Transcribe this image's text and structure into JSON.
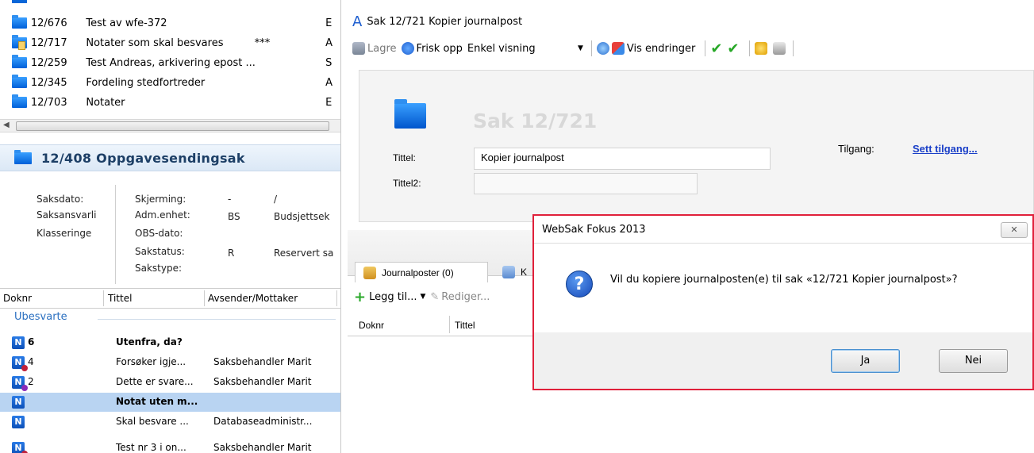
{
  "case_list": [
    {
      "number": "12/676",
      "title": "Test av wfe-372",
      "mark": "",
      "tail": "E",
      "icon": "folder-icon"
    },
    {
      "number": "12/717",
      "title": "Notater som skal besvares",
      "mark": "***",
      "tail": "A",
      "icon": "folder-note-icon"
    },
    {
      "number": "12/259",
      "title": "Test Andreas, arkivering epost ...",
      "mark": "",
      "tail": "S",
      "icon": "folder-icon"
    },
    {
      "number": "12/345",
      "title": "Fordeling stedfortreder",
      "mark": "",
      "tail": "A",
      "icon": "folder-icon"
    },
    {
      "number": "12/703",
      "title": "Notater",
      "mark": "",
      "tail": "E",
      "icon": "folder-icon"
    }
  ],
  "case_detail": {
    "header": "12/408  Oppgavesendingsak",
    "labels_left": [
      "Saksdato:",
      "Saksansvarli",
      "Klasseringe"
    ],
    "labels_mid": [
      "Skjerming:",
      "Adm.enhet:",
      "OBS-dato:",
      "Sakstatus:",
      "Sakstype:"
    ],
    "values_code": [
      "-",
      "BS",
      "",
      "R",
      ""
    ],
    "values_text": [
      "/",
      "Budsjettsek",
      "",
      "Reservert sa",
      ""
    ]
  },
  "doc_table": {
    "headers": [
      "Doknr",
      "Tittel",
      "Avsender/Mottaker"
    ],
    "group": "Ubesvarte",
    "rows": [
      {
        "num": "6",
        "title": "Utenfra, da?",
        "sender": "",
        "bold": true,
        "selected": false,
        "badge": ""
      },
      {
        "num": "4",
        "title": "Forsøker igje...",
        "sender": "Saksbehandler Marit",
        "bold": false,
        "selected": false,
        "badge": "#c0203a"
      },
      {
        "num": "2",
        "title": "Dette er svare...",
        "sender": "Saksbehandler Marit",
        "bold": false,
        "selected": false,
        "badge": "#8a2bb8"
      },
      {
        "num": "",
        "title": "Notat uten m...",
        "sender": "",
        "bold": true,
        "selected": true,
        "badge": ""
      },
      {
        "num": "",
        "title": "Skal besvare ...",
        "sender": "Databaseadministr...",
        "bold": false,
        "selected": false,
        "badge": ""
      },
      {
        "num": "",
        "title": "Test nr 3 i on...",
        "sender": "Saksbehandler Marit",
        "bold": false,
        "selected": false,
        "badge": "#c0203a"
      }
    ]
  },
  "window": {
    "title": "Sak 12/721 Kopier journalpost",
    "app_letter": "A"
  },
  "toolbar": {
    "save": "Lagre",
    "refresh": "Frisk opp",
    "view": "Enkel visning",
    "show_changes": "Vis endringer"
  },
  "case_form": {
    "heading": "Sak 12/721",
    "title_label": "Tittel:",
    "title_value": "Kopier journalpost",
    "title2_label": "Tittel2:",
    "title2_value": "",
    "access_label": "Tilgang:",
    "access_link": "Sett tilgang..."
  },
  "tabs": {
    "journal": "Journalposter (0)",
    "other": "K"
  },
  "actions": {
    "add": "Legg til...",
    "edit": "Rediger..."
  },
  "journal_list": {
    "headers": [
      "Doknr",
      "Tittel"
    ]
  },
  "dialog": {
    "title": "WebSak Fokus 2013",
    "message": "Vil du kopiere journalposten(e) til sak «12/721 Kopier journalpost»?",
    "yes": "Ja",
    "no": "Nei"
  },
  "colors": {
    "accent": "#1a3fc8",
    "selection": "#b9d4f2",
    "dialog_border": "#e0203a"
  }
}
